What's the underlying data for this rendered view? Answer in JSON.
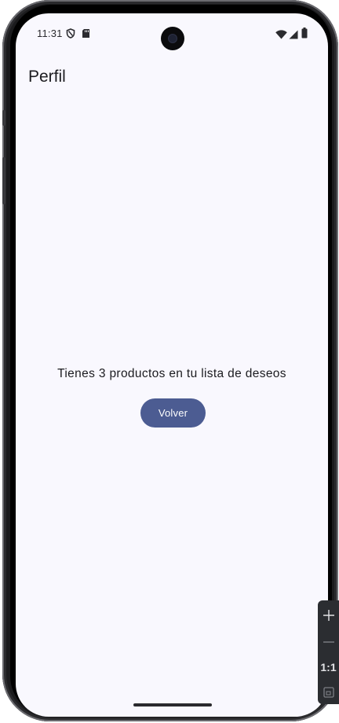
{
  "status_bar": {
    "time": "11:31",
    "left_icons": [
      "shield-icon",
      "sd-card-icon"
    ],
    "right_icons": [
      "wifi-icon",
      "signal-icon",
      "battery-icon"
    ]
  },
  "app_bar": {
    "title": "Perfil"
  },
  "content": {
    "message": "Tienes 3 productos en tu lista de deseos",
    "back_button_label": "Volver"
  },
  "emulator_toolbar": {
    "zoom_in_icon": "plus-icon",
    "zoom_out_icon": "minus-icon",
    "actual_size_label": "1:1",
    "fit_icon": "fit-screen-icon"
  },
  "colors": {
    "screen_background": "#f9f8fe",
    "button_background": "#4c5c92",
    "button_text": "#ffffff",
    "text_primary": "#1b1b1f"
  }
}
